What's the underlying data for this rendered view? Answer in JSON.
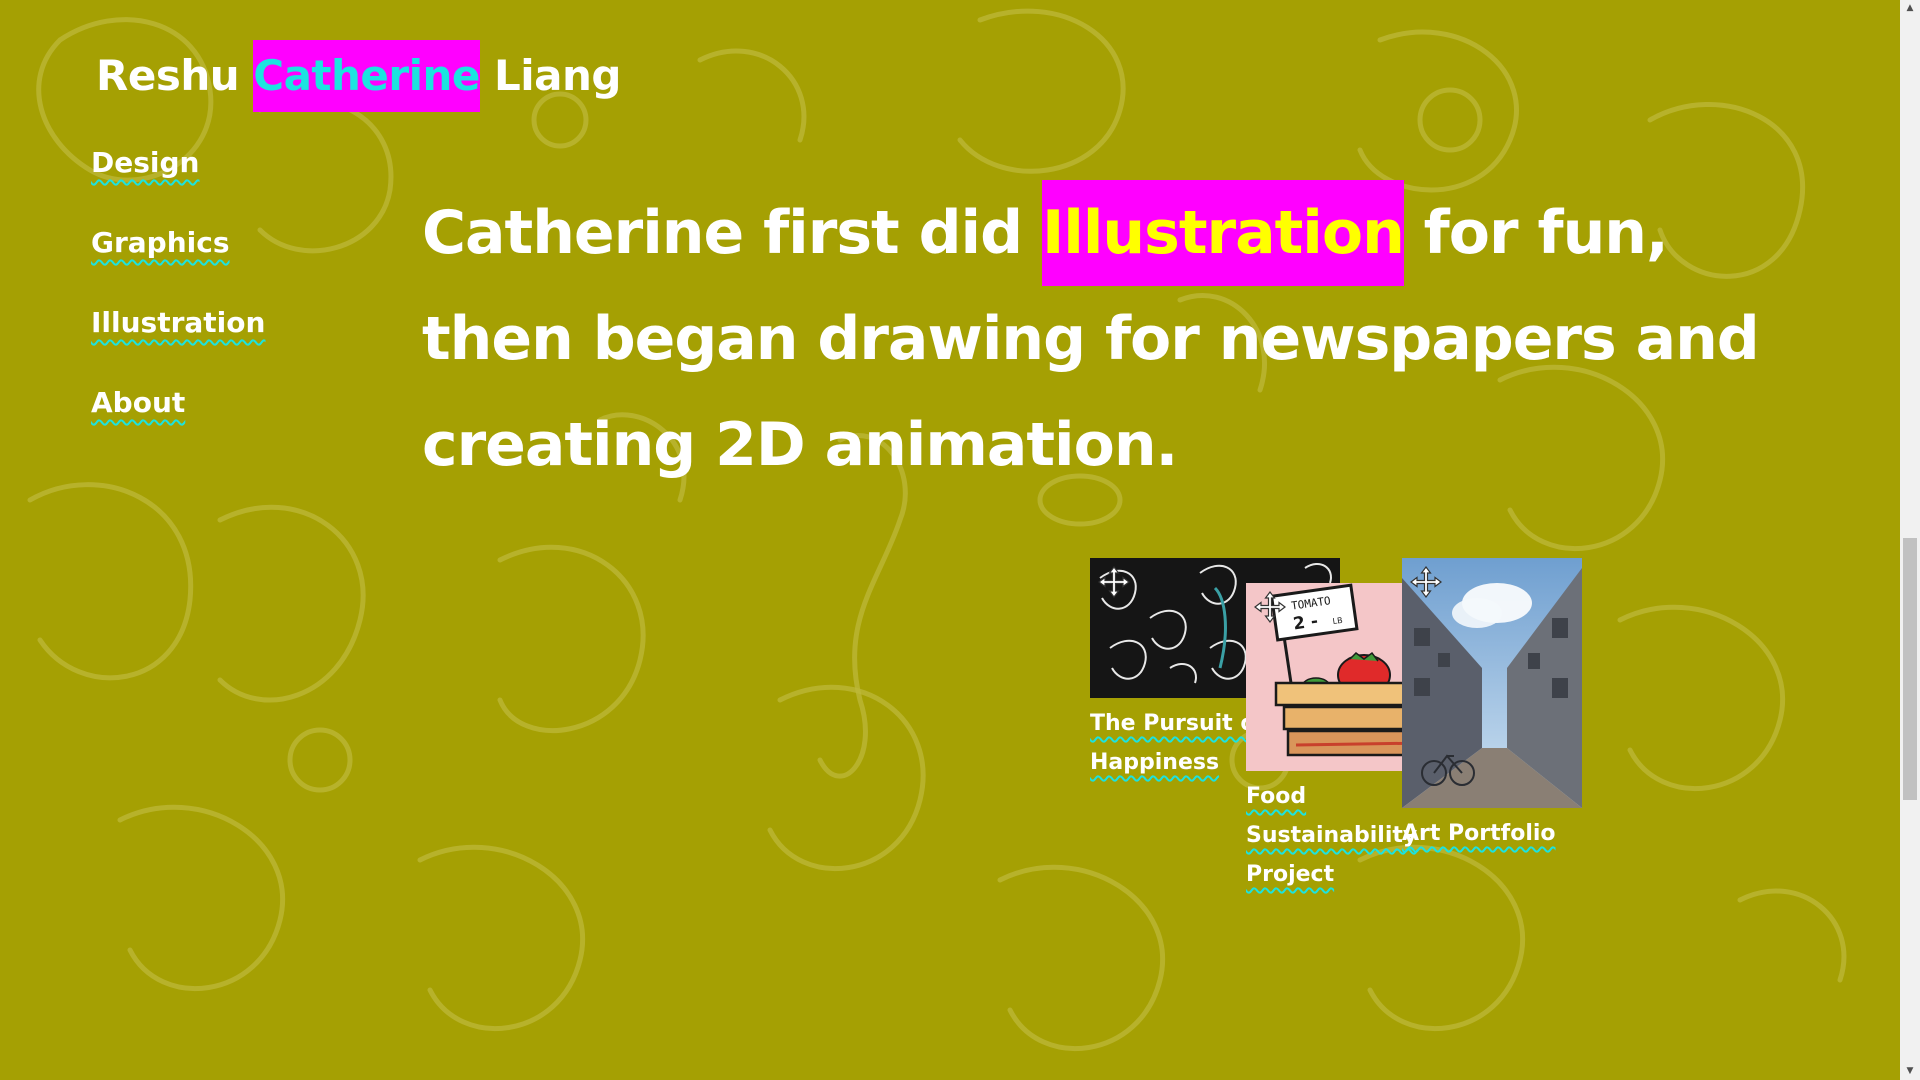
{
  "site_title": {
    "first": "Reshu ",
    "highlight": "Catherine",
    "last": " Liang"
  },
  "nav": {
    "items": [
      {
        "label": "Design"
      },
      {
        "label": "Graphics"
      },
      {
        "label": "Illustration"
      },
      {
        "label": "About"
      }
    ]
  },
  "headline": {
    "before": "Catherine first did ",
    "highlight": "Illustration",
    "after": " for fun, then began drawing for newspapers and creating 2D animation."
  },
  "projects": [
    {
      "title": "The Pursuit of Happiness",
      "icon": "move-icon"
    },
    {
      "title": "Food Sustainability Project",
      "icon": "move-icon",
      "sign_text": "TOMATO",
      "sign_price": "2 -",
      "sign_unit": "LB"
    },
    {
      "title": "Art Portfolio",
      "icon": "move-icon"
    }
  ],
  "colors": {
    "background": "#a5a003",
    "highlight_bg": "#ff00ff",
    "title_highlight_text": "#1ce3e0",
    "headline_highlight_text": "#ffff00",
    "underline": "#1ce3e0"
  }
}
